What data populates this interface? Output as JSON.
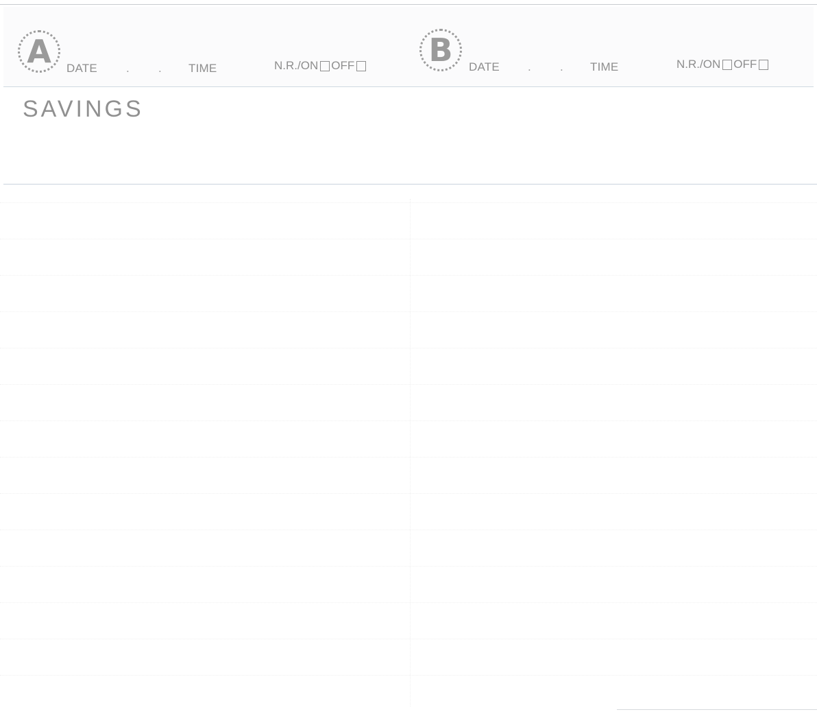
{
  "sections": [
    {
      "letter": "A",
      "date_label": "DATE",
      "time_label": "TIME",
      "nr_label": "N.R./ON",
      "off_label": "OFF"
    },
    {
      "letter": "B",
      "date_label": "DATE",
      "time_label": "TIME",
      "nr_label": "N.R./ON",
      "off_label": "OFF"
    }
  ],
  "title": "SAVINGS",
  "separator_dot": "."
}
